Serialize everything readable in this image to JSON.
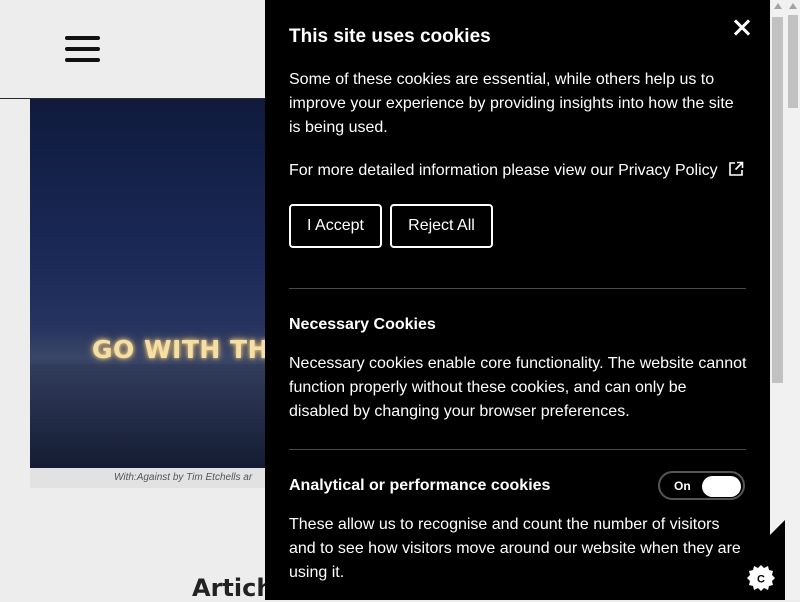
{
  "header": {
    "menu_icon": "hamburger-menu-icon"
  },
  "hero": {
    "neon_text": "GO WITH THE",
    "caption": "With:Against by Tim Etchells ar"
  },
  "article": {
    "heading_partial": "Artich"
  },
  "cookie_panel": {
    "title": "This site uses cookies",
    "intro": "Some of these cookies are essential, while others help us to improve your experience by providing insights into how the site is being used.",
    "more_info_text": "For more detailed information please view our",
    "privacy_link": "Privacy Policy",
    "accept_label": "I Accept",
    "reject_label": "Reject All",
    "sections": [
      {
        "title": "Necessary Cookies",
        "description": "Necessary cookies enable core functionality. The website cannot function properly without these cookies, and can only be disabled by changing your browser preferences."
      },
      {
        "title": "Analytical or performance cookies",
        "description": "These allow us to recognise and count the number of visitors and to see how visitors move around our website when they are using it.",
        "toggle_label": "On",
        "toggle_on": true
      }
    ]
  },
  "colors": {
    "panel_bg": "#000000",
    "panel_text": "#ffffff",
    "page_bg": "#ededed"
  }
}
